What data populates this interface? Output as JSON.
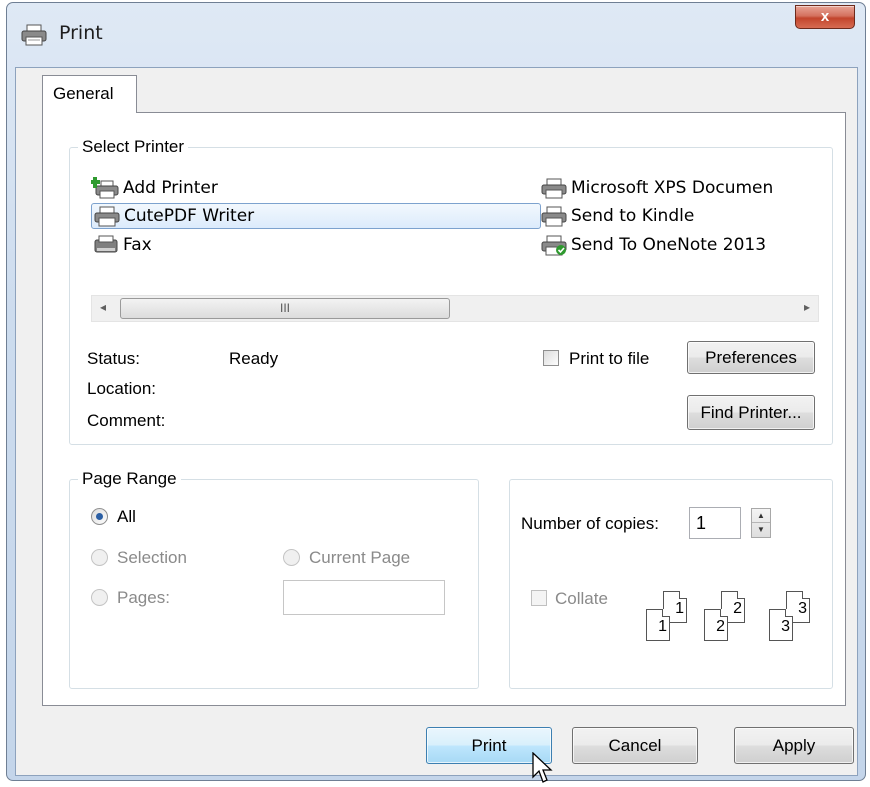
{
  "window": {
    "title": "Print",
    "close_symbol": "x"
  },
  "tabs": [
    {
      "label": "General"
    }
  ],
  "select_printer": {
    "group_title": "Select Printer",
    "printers_left": [
      {
        "name": "Add Printer",
        "icon": "add-printer-icon"
      },
      {
        "name": "CutePDF Writer",
        "icon": "printer-icon",
        "selected": true
      },
      {
        "name": "Fax",
        "icon": "fax-icon"
      }
    ],
    "printers_right": [
      {
        "name": "Microsoft XPS Documen",
        "icon": "printer-icon"
      },
      {
        "name": "Send to Kindle",
        "icon": "printer-icon"
      },
      {
        "name": "Send To OneNote 2013",
        "icon": "printer-check-icon"
      }
    ],
    "scrollbar": {
      "left_arrow": "◂",
      "right_arrow": "▸",
      "thumb_grip": "III"
    },
    "status_label": "Status:",
    "status_value": "Ready",
    "location_label": "Location:",
    "comment_label": "Comment:",
    "print_to_file_label": "Print to file",
    "preferences_label": "Preferences",
    "find_printer_label": "Find Printer..."
  },
  "page_range": {
    "group_title": "Page Range",
    "all_label": "All",
    "selection_label": "Selection",
    "current_page_label": "Current Page",
    "pages_label": "Pages:",
    "pages_value": ""
  },
  "copies": {
    "label": "Number of copies:",
    "value": "1",
    "collate_label": "Collate",
    "collate_pages": [
      {
        "back": "1",
        "front": "1"
      },
      {
        "back": "2",
        "front": "2"
      },
      {
        "back": "3",
        "front": "3"
      }
    ]
  },
  "buttons": {
    "print": "Print",
    "cancel": "Cancel",
    "apply": "Apply"
  },
  "colors": {
    "accent": "#3c7fb1",
    "title_bar": "#cddcee",
    "close": "#c2452c"
  }
}
